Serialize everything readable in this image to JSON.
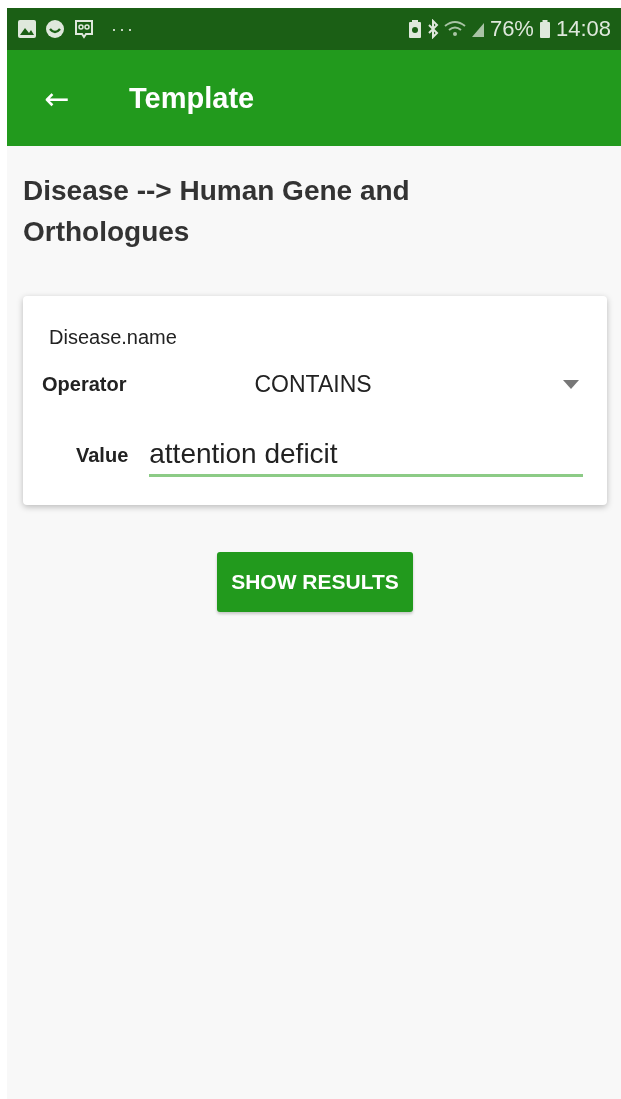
{
  "status_bar": {
    "more": "···",
    "battery_percent": "76%",
    "time": "14:08"
  },
  "app_bar": {
    "back": "←",
    "title": "Template"
  },
  "heading": "Disease --> Human Gene and Orthologues",
  "card": {
    "field_name": "Disease.name",
    "operator_label": "Operator",
    "operator_value": "CONTAINS",
    "value_label": "Value",
    "value": "attention deficit"
  },
  "button": "SHOW RESULTS"
}
